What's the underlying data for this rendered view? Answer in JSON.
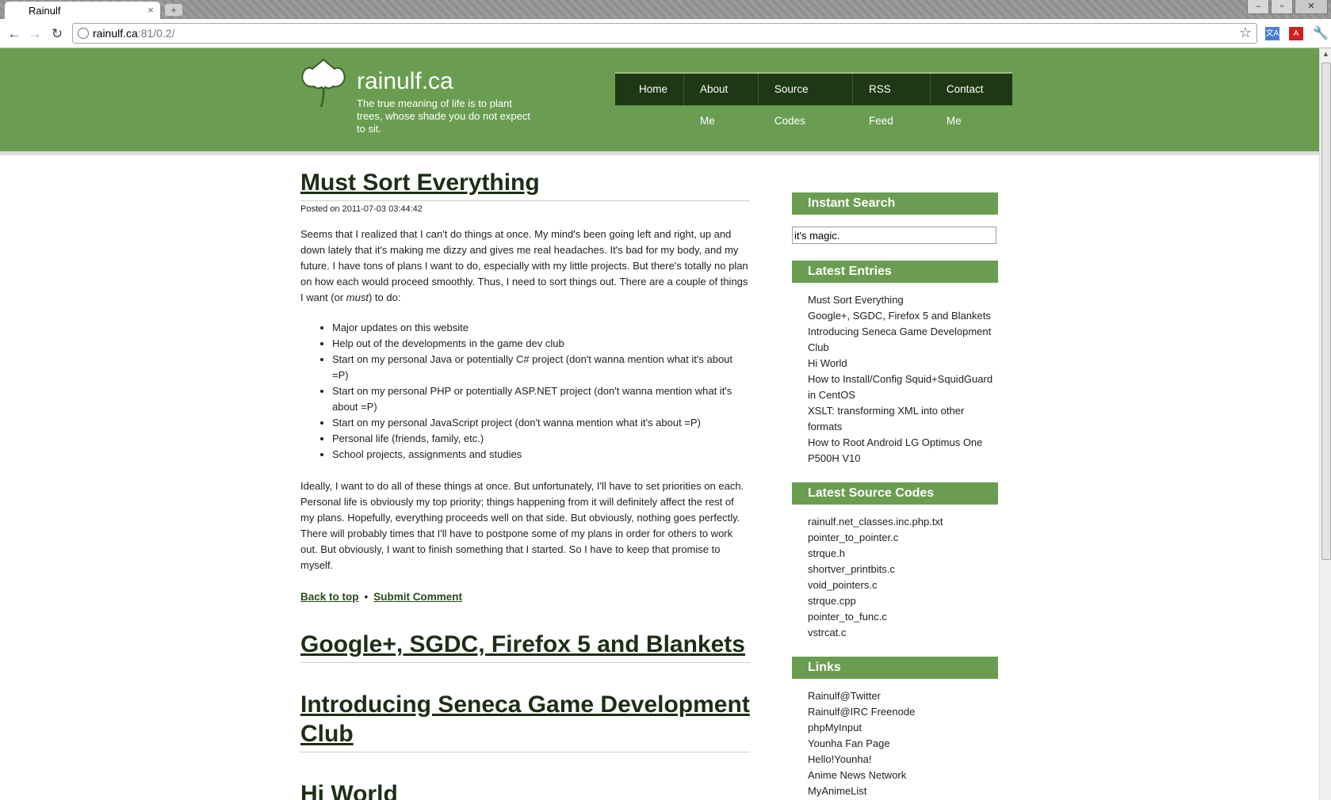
{
  "browser": {
    "tab_title": "Rainulf",
    "tab_close": "×",
    "new_tab": "+",
    "url_host": "rainulf.ca",
    "url_rest": ":81/0.2/",
    "star": "☆",
    "win_minimize": "–",
    "win_maximize": "▫",
    "win_close": "✕"
  },
  "header": {
    "site_title": "rainulf.ca",
    "tagline": "The true meaning of life is to plant trees, whose shade you do not expect to sit.",
    "nav": [
      "Home",
      "About Me",
      "Source Codes",
      "RSS Feed",
      "Contact Me"
    ]
  },
  "post": {
    "title": "Must Sort Everything",
    "posted": "Posted on 2011-07-03 03:44:42",
    "para1_before_em": "Seems that I realized that I can't do things at once. My mind's been going left and right, up and down lately that it's making me dizzy and gives me real headaches. It's bad for my body, and my future. I have tons of plans I want to do, especially with my little projects. But there's totally no plan on how each would proceed smoothly. Thus, I need to sort things out. There are a couple of things I want (or ",
    "para1_em": "must",
    "para1_after_em": ") to do:",
    "bullets": [
      "Major updates on this website",
      "Help out of the developments in the game dev club",
      "Start on my personal Java or potentially C# project (don't wanna mention what it's about =P)",
      "Start on my personal PHP or potentially ASP.NET project (don't wanna mention what it's about =P)",
      "Start on my personal JavaScript project (don't wanna mention what it's about =P)",
      "Personal life (friends, family, etc.)",
      "School projects, assignments and studies"
    ],
    "para2": "Ideally, I want to do all of these things at once. But unfortunately, I'll have to set priorities on each. Personal life is obviously my top priority; things happening from it will definitely affect the rest of my plans. Hopefully, everything proceeds well on that side. But obviously, nothing goes perfectly. There will probably times that I'll have to postpone some of my plans in order for others to work out. But obviously, I want to finish something that I started. So I have to keep that promise to myself.",
    "back_to_top": "Back to top",
    "separator": "•",
    "submit_comment": "Submit Comment"
  },
  "other_posts": [
    "Google+, SGDC, Firefox 5 and Blankets",
    "Introducing Seneca Game Development Club",
    "Hi World"
  ],
  "sidebar": {
    "instant_search_title": "Instant Search",
    "search_value": "it's magic.",
    "latest_entries_title": "Latest Entries",
    "latest_entries": [
      "Must Sort Everything",
      "Google+, SGDC, Firefox 5 and Blankets",
      "Introducing Seneca Game Development Club",
      "Hi World",
      "How to Install/Config Squid+SquidGuard in CentOS",
      "XSLT: transforming XML into other formats",
      "How to Root Android LG Optimus One P500H V10"
    ],
    "latest_sources_title": "Latest Source Codes",
    "latest_sources": [
      "rainulf.net_classes.inc.php.txt",
      "pointer_to_pointer.c",
      "strque.h",
      "shortver_printbits.c",
      "void_pointers.c",
      "strque.cpp",
      "pointer_to_func.c",
      "vstrcat.c"
    ],
    "links_title": "Links",
    "links": [
      "Rainulf@Twitter",
      "Rainulf@IRC Freenode",
      "phpMyInput",
      "Younha Fan Page",
      "Hello!Younha!",
      "Anime News Network",
      "MyAnimeList"
    ]
  },
  "colors": {
    "header_green": "#6a9d51",
    "nav_dark": "#1e3714",
    "title_text": "#1f2d17"
  }
}
